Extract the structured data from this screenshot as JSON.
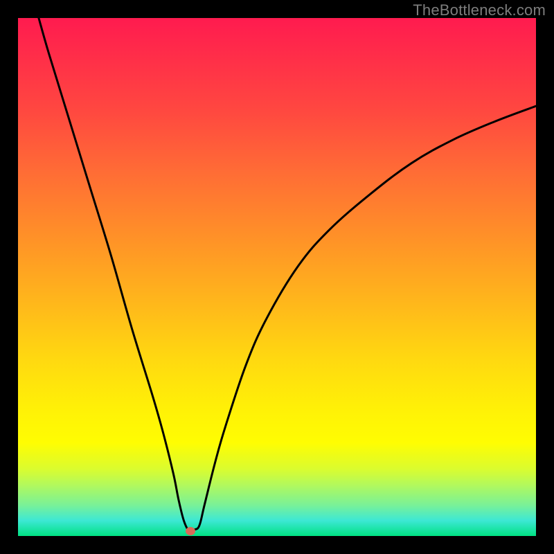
{
  "watermark": "TheBottleneck.com",
  "colors": {
    "frame": "#000000",
    "curve_stroke": "#000000",
    "dot_fill": "#d96a59"
  },
  "chart_data": {
    "type": "line",
    "title": "",
    "xlabel": "",
    "ylabel": "",
    "xlim": [
      0,
      100
    ],
    "ylim": [
      0,
      100
    ],
    "grid": false,
    "series": [
      {
        "name": "curve-left",
        "x": [
          4,
          6,
          10,
          14,
          18,
          22,
          26,
          28,
          30,
          31,
          32,
          33,
          34
        ],
        "y": [
          100,
          93,
          80,
          67,
          54,
          40,
          27,
          20,
          12,
          7,
          3,
          1,
          1.2
        ]
      },
      {
        "name": "curve-right",
        "x": [
          34,
          35,
          36,
          38,
          40,
          44,
          48,
          54,
          60,
          68,
          76,
          84,
          92,
          100
        ],
        "y": [
          1.2,
          2,
          6,
          14,
          21,
          33,
          42,
          52,
          59,
          66,
          72,
          76.5,
          80,
          83
        ]
      }
    ],
    "marker": {
      "x": 33.3,
      "y": 0.9
    }
  }
}
